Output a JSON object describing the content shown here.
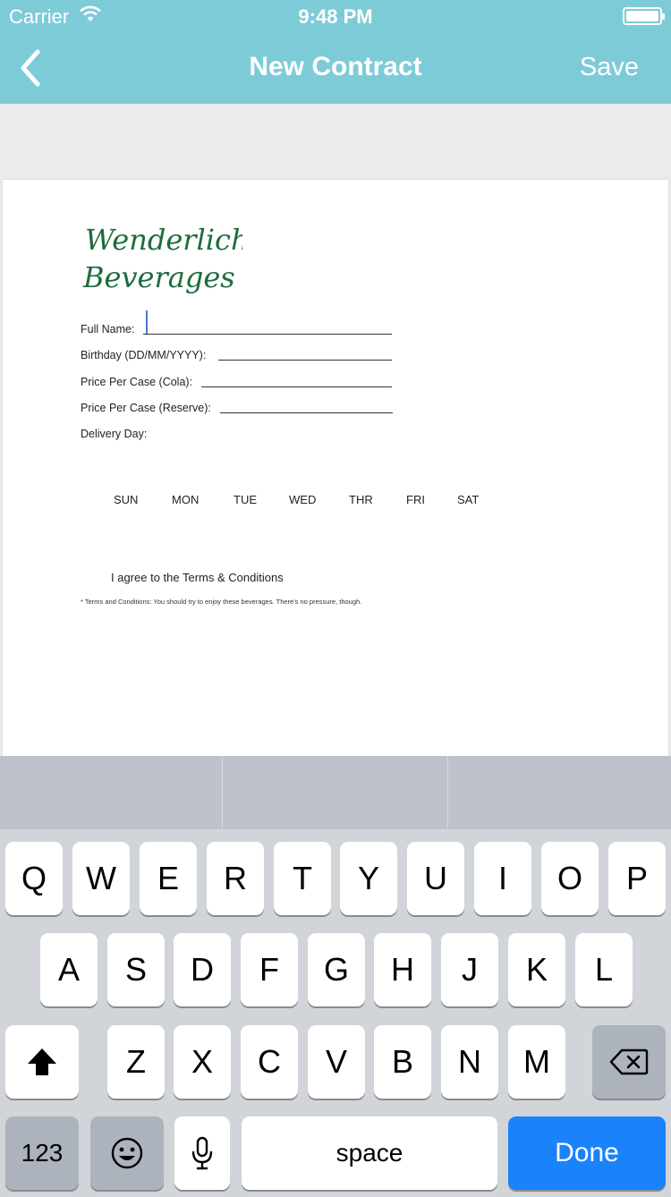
{
  "status": {
    "carrier": "Carrier",
    "time": "9:48 PM"
  },
  "nav": {
    "title": "New Contract",
    "save": "Save",
    "back_icon": "chevron-left-icon"
  },
  "document": {
    "logo_text": [
      "Wenderlich",
      "Beverages"
    ],
    "fields": [
      "Full Name:",
      "Birthday (DD/MM/YYYY):",
      "Price Per Case (Cola):",
      "Price Per Case (Reserve):",
      "Delivery Day:"
    ],
    "days": [
      "SUN",
      "MON",
      "TUE",
      "WED",
      "THR",
      "FRI",
      "SAT"
    ],
    "agree": "I agree to the Terms & Conditions",
    "fine_print": "* Terms and Conditions: You should try to enjoy these beverages. There's no pressure, though."
  },
  "keyboard": {
    "row1": [
      "Q",
      "W",
      "E",
      "R",
      "T",
      "Y",
      "U",
      "I",
      "O",
      "P"
    ],
    "row2": [
      "A",
      "S",
      "D",
      "F",
      "G",
      "H",
      "J",
      "K",
      "L"
    ],
    "row3": [
      "Z",
      "X",
      "C",
      "V",
      "B",
      "N",
      "M"
    ],
    "numbers": "123",
    "space": "space",
    "done": "Done",
    "shift_icon": "shift-icon",
    "backspace_icon": "backspace-icon",
    "emoji_icon": "emoji-icon",
    "mic_icon": "microphone-icon"
  },
  "colors": {
    "nav": "#7ecbd8",
    "done": "#1a82fb",
    "logo": "#1e6b3c"
  }
}
